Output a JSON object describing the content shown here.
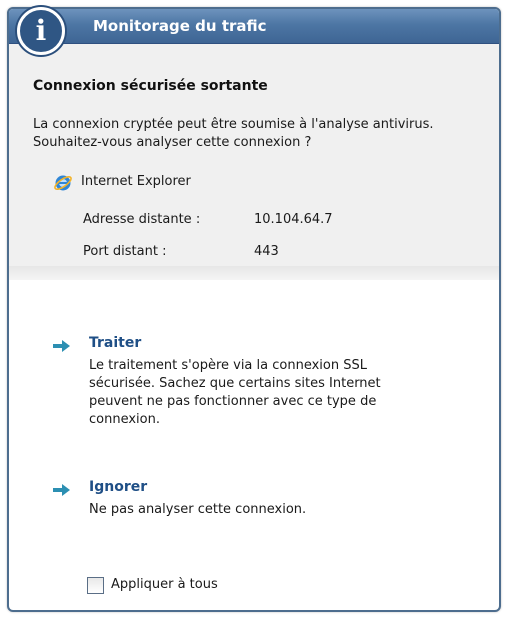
{
  "window": {
    "title": "Monitorage du trafic",
    "icon": "info-icon",
    "accent": "#4d76a4"
  },
  "header": {
    "heading": "Connexion sécurisée sortante",
    "question": "La connexion cryptée peut être soumise à l'analyse antivirus. Souhaitez-vous analyser cette connexion ?",
    "app": {
      "icon": "internet-explorer-icon",
      "name": "Internet Explorer"
    },
    "remote_address_label": "Adresse distante :",
    "remote_address_value": "10.104.64.7",
    "remote_port_label": "Port distant :",
    "remote_port_value": "443"
  },
  "actions": [
    {
      "title": "Traiter",
      "description": "Le traitement s'opère via la connexion SSL sécurisée. Sachez que certains sites Internet peuvent ne pas fonctionner avec ce type de connexion.",
      "icon": "arrow-right-icon"
    },
    {
      "title": "Ignorer",
      "description": "Ne pas analyser cette connexion.",
      "icon": "arrow-right-icon"
    }
  ],
  "apply_all": {
    "label": "Appliquer à tous",
    "checked": false
  }
}
